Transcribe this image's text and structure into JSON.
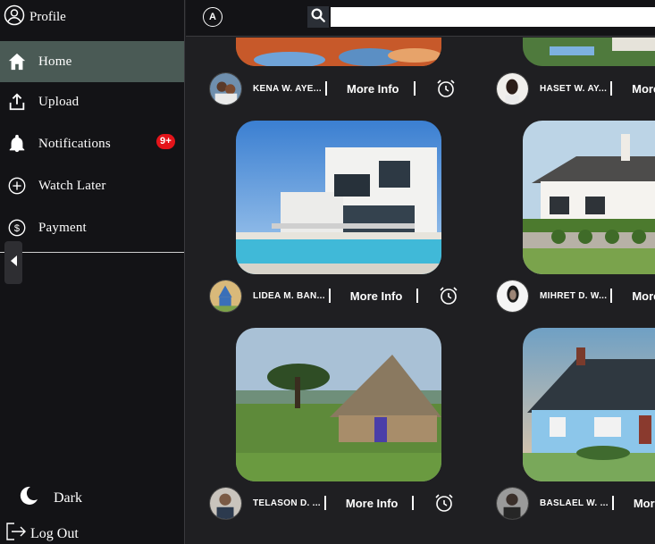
{
  "sidebar": {
    "profile_label": "Profile",
    "items": [
      {
        "label": "Home"
      },
      {
        "label": "Upload"
      },
      {
        "label": "Notifications",
        "badge": "9+"
      },
      {
        "label": "Watch Later"
      },
      {
        "label": "Payment"
      }
    ],
    "theme_label": "Dark",
    "logout_label": "Log Out"
  },
  "topbar": {
    "logo_text": "A",
    "search_placeholder": ""
  },
  "feed": {
    "more_label": "More Info",
    "cards": [
      {
        "owner": "KENA W. AYE...",
        "scene": "garden-house"
      },
      {
        "owner": "HASET W. AY...",
        "scene": "lawn-house"
      },
      {
        "owner": "LIDEA M. BAN...",
        "scene": "modern-villa"
      },
      {
        "owner": "MIHRET D. W...",
        "scene": "white-cottage"
      },
      {
        "owner": "TELASON D. ...",
        "scene": "thatched-hut"
      },
      {
        "owner": "BASLAEL W. ...",
        "scene": "blue-house"
      }
    ]
  },
  "colors": {
    "background": "#1f1f22",
    "sidebar": "#131316",
    "active_item": "#4a5a55",
    "badge": "#e4141a"
  }
}
